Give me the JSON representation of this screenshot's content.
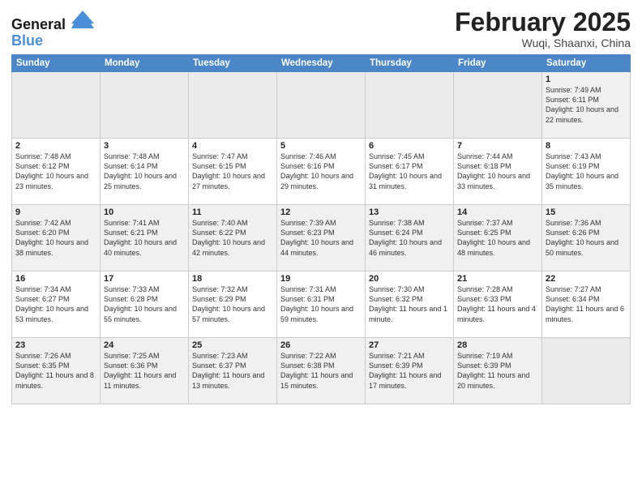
{
  "header": {
    "logo_line1": "General",
    "logo_line2": "Blue",
    "month_title": "February 2025",
    "subtitle": "Wuqi, Shaanxi, China"
  },
  "days_of_week": [
    "Sunday",
    "Monday",
    "Tuesday",
    "Wednesday",
    "Thursday",
    "Friday",
    "Saturday"
  ],
  "weeks": [
    [
      {
        "num": "",
        "info": ""
      },
      {
        "num": "",
        "info": ""
      },
      {
        "num": "",
        "info": ""
      },
      {
        "num": "",
        "info": ""
      },
      {
        "num": "",
        "info": ""
      },
      {
        "num": "",
        "info": ""
      },
      {
        "num": "1",
        "info": "Sunrise: 7:49 AM\nSunset: 6:11 PM\nDaylight: 10 hours\nand 22 minutes."
      }
    ],
    [
      {
        "num": "2",
        "info": "Sunrise: 7:48 AM\nSunset: 6:12 PM\nDaylight: 10 hours\nand 23 minutes."
      },
      {
        "num": "3",
        "info": "Sunrise: 7:48 AM\nSunset: 6:14 PM\nDaylight: 10 hours\nand 25 minutes."
      },
      {
        "num": "4",
        "info": "Sunrise: 7:47 AM\nSunset: 6:15 PM\nDaylight: 10 hours\nand 27 minutes."
      },
      {
        "num": "5",
        "info": "Sunrise: 7:46 AM\nSunset: 6:16 PM\nDaylight: 10 hours\nand 29 minutes."
      },
      {
        "num": "6",
        "info": "Sunrise: 7:45 AM\nSunset: 6:17 PM\nDaylight: 10 hours\nand 31 minutes."
      },
      {
        "num": "7",
        "info": "Sunrise: 7:44 AM\nSunset: 6:18 PM\nDaylight: 10 hours\nand 33 minutes."
      },
      {
        "num": "8",
        "info": "Sunrise: 7:43 AM\nSunset: 6:19 PM\nDaylight: 10 hours\nand 35 minutes."
      }
    ],
    [
      {
        "num": "9",
        "info": "Sunrise: 7:42 AM\nSunset: 6:20 PM\nDaylight: 10 hours\nand 38 minutes."
      },
      {
        "num": "10",
        "info": "Sunrise: 7:41 AM\nSunset: 6:21 PM\nDaylight: 10 hours\nand 40 minutes."
      },
      {
        "num": "11",
        "info": "Sunrise: 7:40 AM\nSunset: 6:22 PM\nDaylight: 10 hours\nand 42 minutes."
      },
      {
        "num": "12",
        "info": "Sunrise: 7:39 AM\nSunset: 6:23 PM\nDaylight: 10 hours\nand 44 minutes."
      },
      {
        "num": "13",
        "info": "Sunrise: 7:38 AM\nSunset: 6:24 PM\nDaylight: 10 hours\nand 46 minutes."
      },
      {
        "num": "14",
        "info": "Sunrise: 7:37 AM\nSunset: 6:25 PM\nDaylight: 10 hours\nand 48 minutes."
      },
      {
        "num": "15",
        "info": "Sunrise: 7:36 AM\nSunset: 6:26 PM\nDaylight: 10 hours\nand 50 minutes."
      }
    ],
    [
      {
        "num": "16",
        "info": "Sunrise: 7:34 AM\nSunset: 6:27 PM\nDaylight: 10 hours\nand 53 minutes."
      },
      {
        "num": "17",
        "info": "Sunrise: 7:33 AM\nSunset: 6:28 PM\nDaylight: 10 hours\nand 55 minutes."
      },
      {
        "num": "18",
        "info": "Sunrise: 7:32 AM\nSunset: 6:29 PM\nDaylight: 10 hours\nand 57 minutes."
      },
      {
        "num": "19",
        "info": "Sunrise: 7:31 AM\nSunset: 6:31 PM\nDaylight: 10 hours\nand 59 minutes."
      },
      {
        "num": "20",
        "info": "Sunrise: 7:30 AM\nSunset: 6:32 PM\nDaylight: 11 hours\nand 1 minute."
      },
      {
        "num": "21",
        "info": "Sunrise: 7:28 AM\nSunset: 6:33 PM\nDaylight: 11 hours\nand 4 minutes."
      },
      {
        "num": "22",
        "info": "Sunrise: 7:27 AM\nSunset: 6:34 PM\nDaylight: 11 hours\nand 6 minutes."
      }
    ],
    [
      {
        "num": "23",
        "info": "Sunrise: 7:26 AM\nSunset: 6:35 PM\nDaylight: 11 hours\nand 8 minutes."
      },
      {
        "num": "24",
        "info": "Sunrise: 7:25 AM\nSunset: 6:36 PM\nDaylight: 11 hours\nand 11 minutes."
      },
      {
        "num": "25",
        "info": "Sunrise: 7:23 AM\nSunset: 6:37 PM\nDaylight: 11 hours\nand 13 minutes."
      },
      {
        "num": "26",
        "info": "Sunrise: 7:22 AM\nSunset: 6:38 PM\nDaylight: 11 hours\nand 15 minutes."
      },
      {
        "num": "27",
        "info": "Sunrise: 7:21 AM\nSunset: 6:39 PM\nDaylight: 11 hours\nand 17 minutes."
      },
      {
        "num": "28",
        "info": "Sunrise: 7:19 AM\nSunset: 6:39 PM\nDaylight: 11 hours\nand 20 minutes."
      },
      {
        "num": "",
        "info": ""
      }
    ]
  ]
}
